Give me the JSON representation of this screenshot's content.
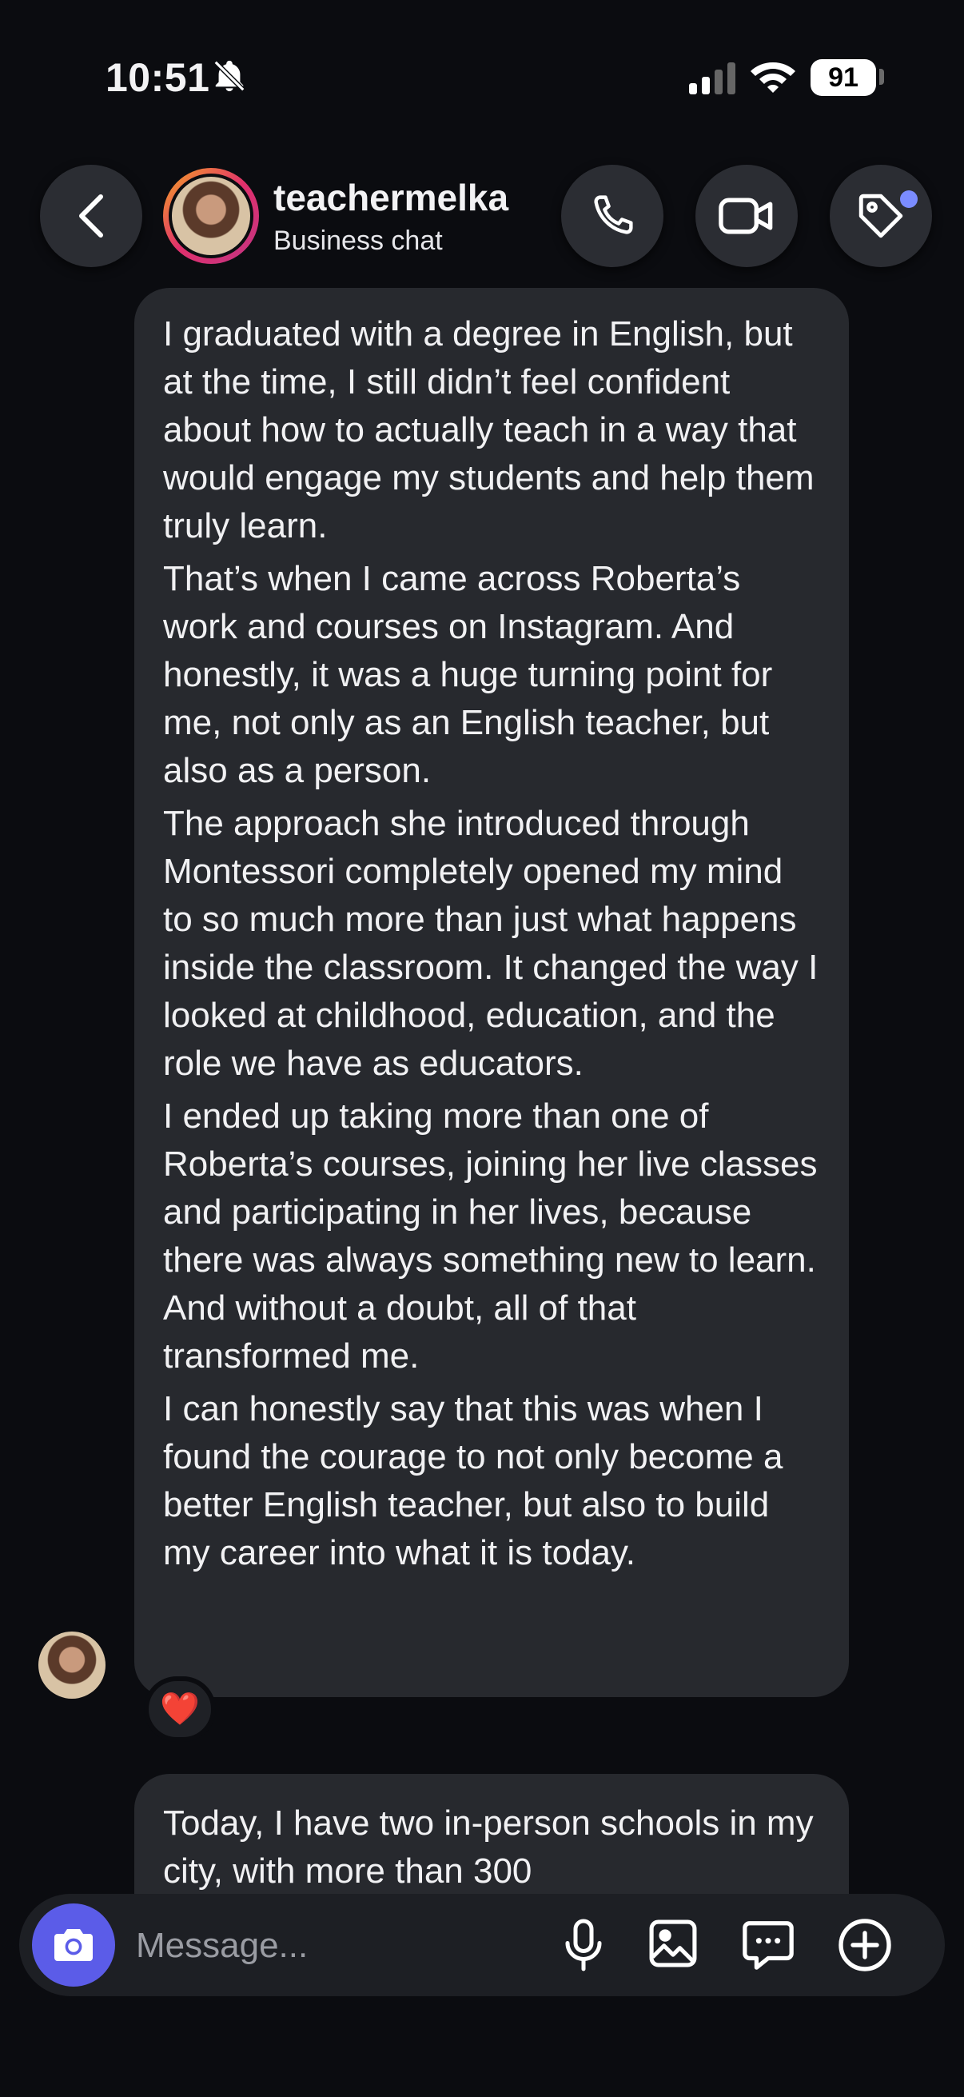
{
  "status_bar": {
    "time": "10:51",
    "battery": "91"
  },
  "header": {
    "username": "teachermelka",
    "subtitle": "Business chat"
  },
  "messages": [
    {
      "paragraphs": [
        "I graduated with a degree in English, but at the time, I still didn’t feel confident about how to actually teach in a way that would engage my students and help them truly learn.",
        "That’s when I came across Roberta’s work and courses on Instagram. And honestly, it was a huge turning point for me, not only as an English teacher, but also as a person.",
        "The approach she introduced through Montessori completely opened my mind to so much more than just what happens inside the classroom. It changed the way I looked at childhood, education, and the role we have as educators.",
        "I ended up taking more than one of Roberta’s courses, joining her live classes and participating in her lives, because there was always something new to learn. And without a doubt, all of that transformed me.",
        "I can honestly say that this was when I found the courage to not only become a better English teacher, but also to build my career into what it is today."
      ],
      "reaction": "❤️"
    },
    {
      "paragraphs": [
        "Today, I have two in-person schools in my city, with more than 300"
      ]
    }
  ],
  "composer": {
    "placeholder": "Message..."
  },
  "colors": {
    "accent": "#5b5ce8",
    "bubble": "#27292e",
    "background": "#0b0c10",
    "notification_dot": "#7b8cff"
  }
}
